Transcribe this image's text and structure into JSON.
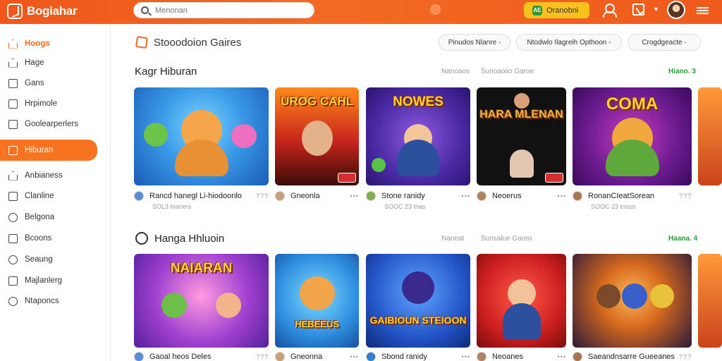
{
  "topbar": {
    "brand": "Bogiahar",
    "search_placeholder": "Menonan",
    "deposit_icon_text": "AE",
    "deposit_label": "Oranobni"
  },
  "sidebar": {
    "items": [
      {
        "label": "Hoogs"
      },
      {
        "label": "Hage"
      },
      {
        "label": "Gans"
      },
      {
        "label": "Hrpimole"
      },
      {
        "label": "Goolearperlers"
      },
      {
        "label": "Hiburan"
      },
      {
        "label": "Anbianess"
      },
      {
        "label": "Clanline"
      },
      {
        "label": "Belgona"
      },
      {
        "label": "Bcoons"
      },
      {
        "label": "Seaung"
      },
      {
        "label": "Majlanlerg"
      },
      {
        "label": "Ntaponcs"
      }
    ]
  },
  "main": {
    "page_title": "Stooodoion Gaires",
    "filters": [
      "Pinudos Nlanre -",
      "Ntodwlo Ilagreih Opthoon -",
      "Crogdgeacte -"
    ],
    "sections": [
      {
        "title": "Kagr Hiburan",
        "meta1": "Nanoaos",
        "meta2": "Sunoaoiio Garoe",
        "link": "Hiano. 3",
        "cards": [
          {
            "thumb_title": "",
            "title": "Rancd hanegl Li-hiodoonlo",
            "sub": "SOL3 tnaners",
            "more": "???"
          },
          {
            "thumb_title": "UROG CAHL",
            "title": "Gneonla",
            "sub": "",
            "more": "•••"
          },
          {
            "thumb_title": "NOWES",
            "title": "Stone ranidy",
            "sub": "SOOC 23 tnas",
            "more": "•••"
          },
          {
            "thumb_title": "HARA MLENAN",
            "title": "Neoerus",
            "sub": "",
            "more": "•••"
          },
          {
            "thumb_title": "COMA",
            "title": "RonanCIeatSorean",
            "sub": "SOOC 23 tnuus",
            "more": "???"
          }
        ]
      },
      {
        "title": "Hanga Hhluoin",
        "meta1": "Naneat",
        "meta2": "Sunsalue Gareo",
        "link": "Haana. 4",
        "cards": [
          {
            "thumb_title": "NAIARAN",
            "title": "Gaoal heos Deles",
            "sub": "",
            "more": "???"
          },
          {
            "thumb_title": "HEBEEUS",
            "title": "Gneonna",
            "sub": "",
            "more": "•••"
          },
          {
            "thumb_title": "GAIBIOUN STEIOON",
            "title": "Sbond ranidy",
            "sub": "",
            "more": "•••"
          },
          {
            "thumb_title": "",
            "title": "Neoanes",
            "sub": "",
            "more": "•••"
          },
          {
            "thumb_title": "",
            "title": "Saeandnsarre Gueeanes",
            "sub": "",
            "more": "???"
          }
        ]
      }
    ]
  },
  "colors": {
    "accent": "#f26a22",
    "active_nav": "#f7731f",
    "deposit": "#f7c21c",
    "link_green": "#2e9a3c"
  },
  "icons": [
    "logo-icon",
    "search-icon",
    "deposit-icon",
    "user-icon",
    "gift-icon",
    "chevron-down-icon",
    "avatar",
    "menu-icon"
  ]
}
